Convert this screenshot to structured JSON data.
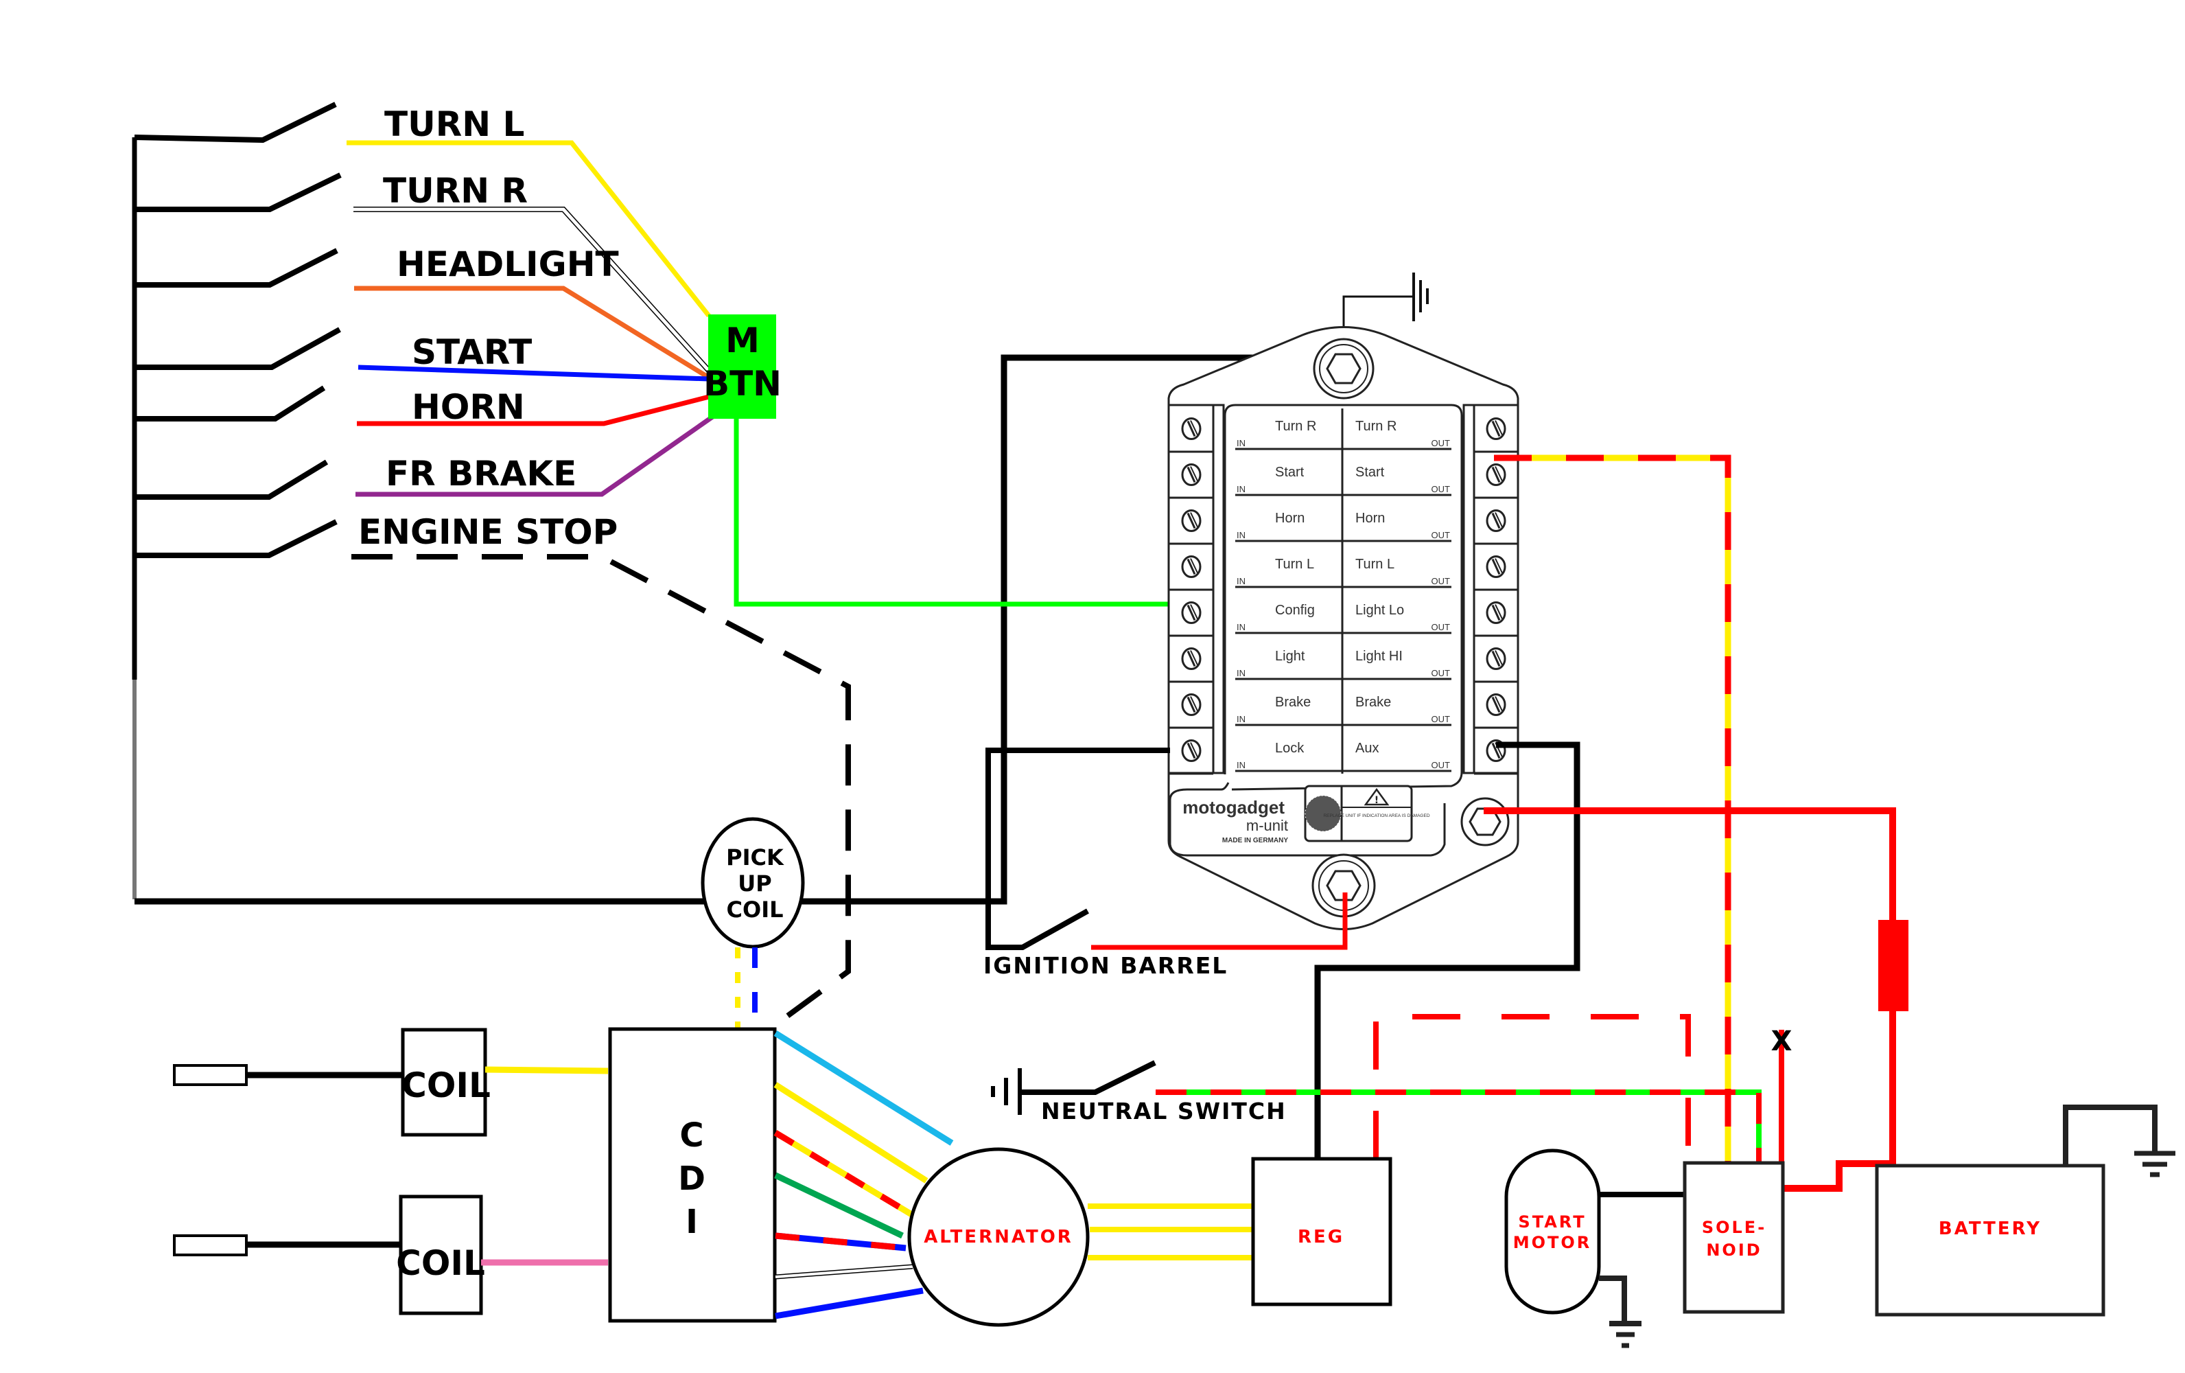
{
  "diagram": {
    "switches": [
      {
        "label": "TURN L",
        "wire_color": "yellow"
      },
      {
        "label": "TURN R",
        "wire_color": "white"
      },
      {
        "label": "HEADLIGHT",
        "wire_color": "orange"
      },
      {
        "label": "START",
        "wire_color": "blue"
      },
      {
        "label": "HORN",
        "wire_color": "red"
      },
      {
        "label": "FR BRAKE",
        "wire_color": "purple"
      },
      {
        "label": "ENGINE STOP",
        "wire_color": "black-dashed"
      }
    ],
    "mbtn": {
      "line1": "M",
      "line2": "BTN"
    },
    "munit": {
      "brand": "motogadget",
      "model": "m-unit",
      "origin": "MADE IN GERMANY",
      "warning": "REPLACE UNIT IF INDICATION AREA IS DAMAGED",
      "in_tag": "IN",
      "out_tag": "OUT",
      "rows": [
        {
          "in": "Turn R",
          "out": "Turn R"
        },
        {
          "in": "Start",
          "out": "Start"
        },
        {
          "in": "Horn",
          "out": "Horn"
        },
        {
          "in": "Turn L",
          "out": "Turn L"
        },
        {
          "in": "Config",
          "out": "Light Lo"
        },
        {
          "in": "Light",
          "out": "Light HI"
        },
        {
          "in": "Brake",
          "out": "Brake"
        },
        {
          "in": "Lock",
          "out": "Aux"
        }
      ]
    },
    "ignition_barrel": "IGNITION BARREL",
    "pickup_coil": [
      "PICK",
      "UP",
      "COIL"
    ],
    "coil_1": "COIL",
    "coil_2": "COIL",
    "cdi": [
      "C",
      "D",
      "I"
    ],
    "alternator": "ALTERNATOR",
    "neutral_switch": "NEUTRAL SWITCH",
    "regulator": "REG",
    "start_motor": [
      "START",
      "MOTOR"
    ],
    "solenoid": [
      "SOLE-",
      "NOID"
    ],
    "battery": "BATTERY",
    "x_mark": "X"
  },
  "colors": {
    "yellow": "#ffee00",
    "white": "#ffffff",
    "orange": "#f26522",
    "blue": "#0010ff",
    "red": "#ff0000",
    "purple": "#92278f",
    "green": "#00ff00",
    "dark_green": "#00a651",
    "cyan": "#1ab7ea",
    "pink": "#ee6fab",
    "mbtn": "#00ff00"
  }
}
